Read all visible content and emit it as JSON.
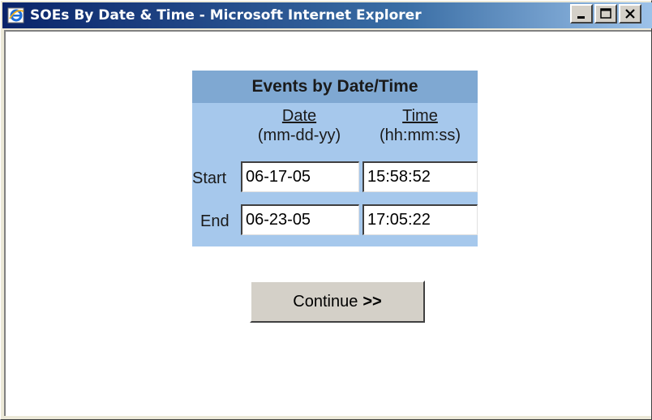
{
  "window": {
    "title": "SOEs By Date & Time - Microsoft Internet Explorer",
    "icon": "internet-explorer-icon",
    "buttons": [
      "minimize",
      "maximize",
      "close"
    ]
  },
  "form": {
    "header": "Events by Date/Time",
    "columns": {
      "date_label": "Date",
      "date_format": "(mm-dd-yy)",
      "time_label": "Time",
      "time_format": "(hh:mm:ss)"
    },
    "rows": [
      {
        "label": "Start",
        "date": "06-17-05",
        "time": "15:58:52"
      },
      {
        "label": "End",
        "date": "06-23-05",
        "time": "17:05:22"
      }
    ],
    "continue_label": "Continue",
    "continue_arrows": ">>"
  },
  "colors": {
    "panel": "#a6c8ec",
    "panel_header": "#7fa8d2",
    "titlebar": "#0a246a"
  }
}
